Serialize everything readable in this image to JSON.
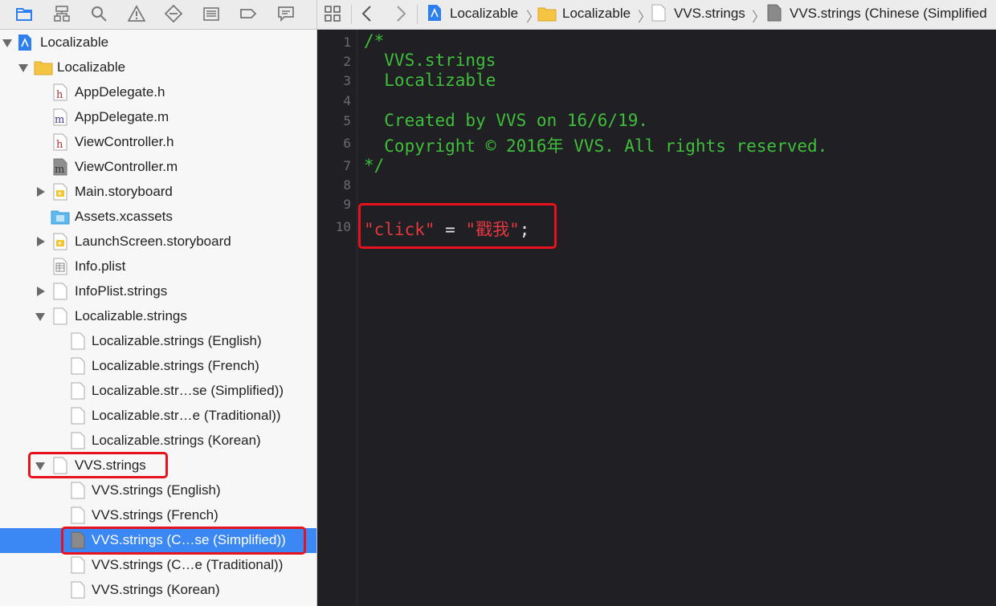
{
  "colors": {
    "selection": "#3b88f4",
    "highlight": "#e8121e",
    "comment": "#3fbf3a",
    "string": "#e2383f",
    "editor_bg": "#1f1f24"
  },
  "navigator_toolbar": {
    "icons": [
      "folder-icon",
      "hierarchy-icon",
      "search-icon",
      "warning-icon",
      "test-icon",
      "debug-icon",
      "breakpoint-icon",
      "report-icon"
    ]
  },
  "jump_bar": {
    "crumbs": [
      "Localizable",
      "Localizable",
      "VVS.strings",
      "VVS.strings (Chinese (Simplified"
    ]
  },
  "tree": [
    {
      "label": "Localizable",
      "type": "project"
    },
    {
      "label": "Localizable",
      "type": "group"
    },
    {
      "label": "AppDelegate.h",
      "type": "h"
    },
    {
      "label": "AppDelegate.m",
      "type": "m"
    },
    {
      "label": "ViewController.h",
      "type": "h"
    },
    {
      "label": "ViewController.m",
      "type": "m"
    },
    {
      "label": "Main.storyboard",
      "type": "storyboard"
    },
    {
      "label": "Assets.xcassets",
      "type": "assets"
    },
    {
      "label": "LaunchScreen.storyboard",
      "type": "storyboard"
    },
    {
      "label": "Info.plist",
      "type": "plist"
    },
    {
      "label": "InfoPlist.strings",
      "type": "strings"
    },
    {
      "label": "Localizable.strings",
      "type": "strings"
    },
    {
      "label": "Localizable.strings (English)",
      "type": "strings"
    },
    {
      "label": "Localizable.strings (French)",
      "type": "strings"
    },
    {
      "label": "Localizable.str…se (Simplified))",
      "type": "strings"
    },
    {
      "label": "Localizable.str…e (Traditional))",
      "type": "strings"
    },
    {
      "label": "Localizable.strings (Korean)",
      "type": "strings"
    },
    {
      "label": "VVS.strings",
      "type": "strings"
    },
    {
      "label": "VVS.strings (English)",
      "type": "strings"
    },
    {
      "label": "VVS.strings (French)",
      "type": "strings"
    },
    {
      "label": "VVS.strings (C…se (Simplified))",
      "type": "strings",
      "selected": true
    },
    {
      "label": "VVS.strings (C…e (Traditional))",
      "type": "strings"
    },
    {
      "label": "VVS.strings (Korean)",
      "type": "strings"
    }
  ],
  "editor": {
    "line_numbers": [
      "1",
      "2",
      "3",
      "4",
      "5",
      "6",
      "7",
      "8",
      "9",
      "10"
    ],
    "lines": {
      "l1": "/*",
      "l2": "  VVS.strings",
      "l3": "  Localizable",
      "l5": "  Created by VVS on 16/6/19.",
      "l6": "  Copyright © 2016年 VVS. All rights reserved.",
      "l7": "*/",
      "l10_key": "\"click\"",
      "l10_eq": " = ",
      "l10_val": "\"戳我\"",
      "l10_end": ";"
    }
  }
}
